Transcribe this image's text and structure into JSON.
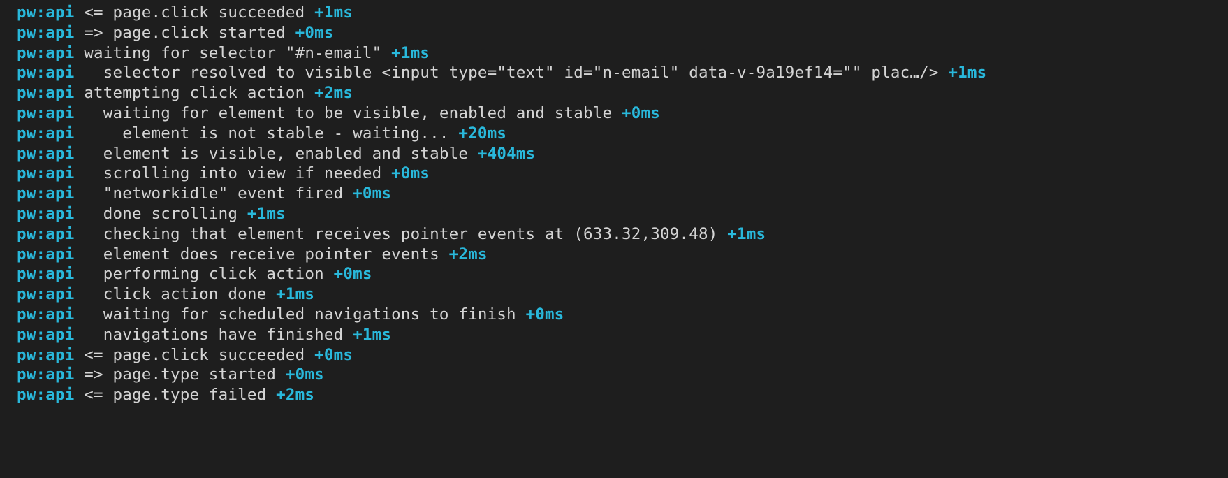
{
  "log": {
    "prefix": "pw:api",
    "lines": [
      {
        "msg": " <= page.click succeeded ",
        "time": "+1ms"
      },
      {
        "msg": " => page.click started ",
        "time": "+0ms"
      },
      {
        "msg": " waiting for selector \"#n-email\" ",
        "time": "+1ms"
      },
      {
        "msg": "   selector resolved to visible <input type=\"text\" id=\"n-email\" data-v-9a19ef14=\"\" plac…/> ",
        "time": "+1ms"
      },
      {
        "msg": " attempting click action ",
        "time": "+2ms"
      },
      {
        "msg": "   waiting for element to be visible, enabled and stable ",
        "time": "+0ms"
      },
      {
        "msg": "     element is not stable - waiting... ",
        "time": "+20ms"
      },
      {
        "msg": "   element is visible, enabled and stable ",
        "time": "+404ms"
      },
      {
        "msg": "   scrolling into view if needed ",
        "time": "+0ms"
      },
      {
        "msg": "   \"networkidle\" event fired ",
        "time": "+0ms"
      },
      {
        "msg": "   done scrolling ",
        "time": "+1ms"
      },
      {
        "msg": "   checking that element receives pointer events at (633.32,309.48) ",
        "time": "+1ms"
      },
      {
        "msg": "   element does receive pointer events ",
        "time": "+2ms"
      },
      {
        "msg": "   performing click action ",
        "time": "+0ms"
      },
      {
        "msg": "   click action done ",
        "time": "+1ms"
      },
      {
        "msg": "   waiting for scheduled navigations to finish ",
        "time": "+0ms"
      },
      {
        "msg": "   navigations have finished ",
        "time": "+1ms"
      },
      {
        "msg": " <= page.click succeeded ",
        "time": "+0ms"
      },
      {
        "msg": " => page.type started ",
        "time": "+0ms"
      },
      {
        "msg": " <= page.type failed ",
        "time": "+2ms"
      }
    ]
  }
}
